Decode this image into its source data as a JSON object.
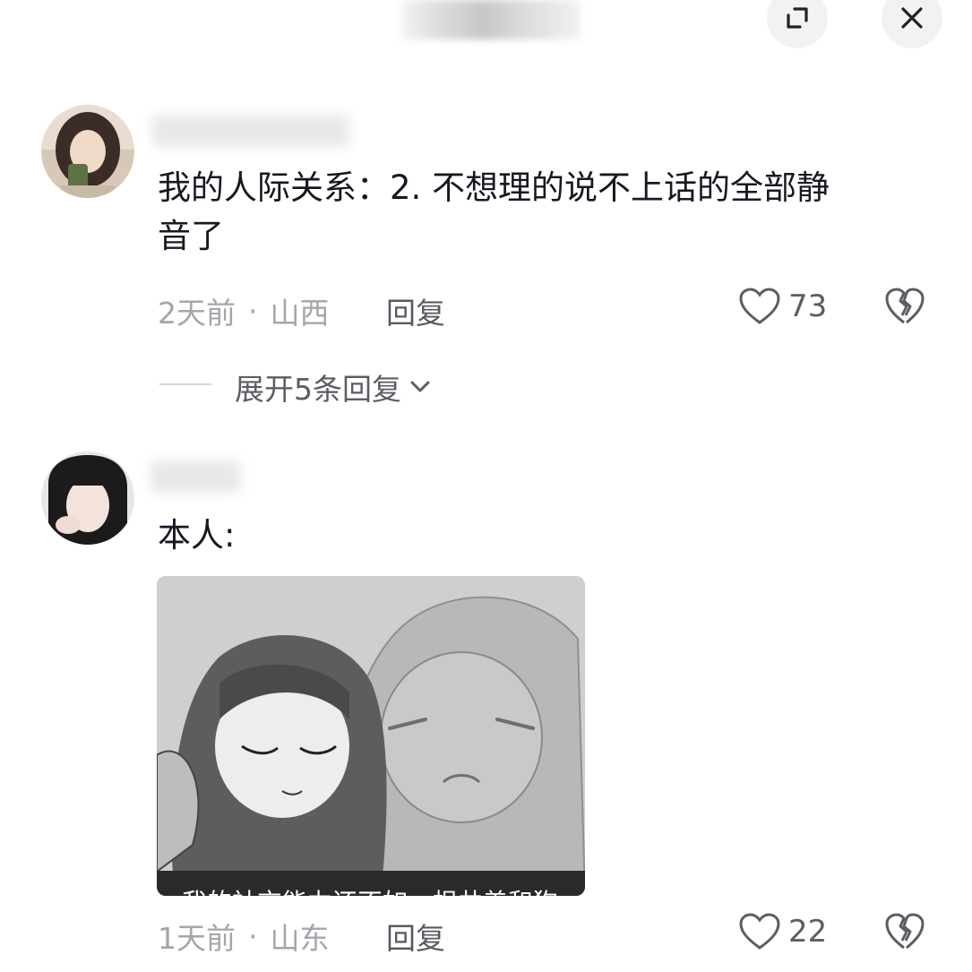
{
  "header": {
    "expand_icon": "expand-arrows-icon",
    "close_icon": "close-icon"
  },
  "comments": [
    {
      "text": "我的人际关系：2. 不想理的说不上话的全部静音了",
      "text_line1": "我的人际关系：2. 不想理的说不上话的全部静",
      "text_line2": "音了",
      "time": "2天前",
      "separator": "·",
      "location": "山西",
      "reply_label": "回复",
      "like_count": "73",
      "expand_replies_label": "展开5条回复"
    },
    {
      "text": "本人:",
      "image_caption": "我的社交能力还不如一根井盖和狗",
      "time": "1天前",
      "separator": "·",
      "location": "山东",
      "reply_label": "回复",
      "like_count": "22"
    }
  ],
  "icons": {
    "like": "heart-outline-icon",
    "dislike": "broken-heart-icon",
    "chevron": "chevron-down-icon"
  }
}
